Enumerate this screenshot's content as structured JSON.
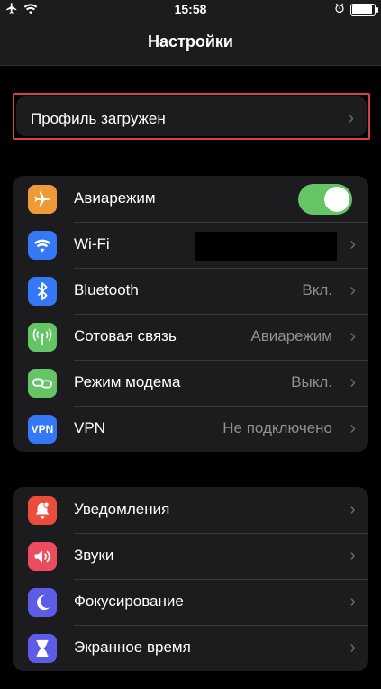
{
  "statusbar": {
    "time": "15:58",
    "battery_level": 0.9
  },
  "navbar": {
    "title": "Настройки"
  },
  "profile": {
    "label": "Профиль загружен"
  },
  "group1": {
    "items": [
      {
        "label": "Авиарежим",
        "icon": "airplane-icon",
        "color": "#f09a37",
        "toggle_on": true
      },
      {
        "label": "Wi-Fi",
        "icon": "wifi-icon",
        "color": "#3478f6",
        "value": ""
      },
      {
        "label": "Bluetooth",
        "icon": "bluetooth-icon",
        "color": "#3478f6",
        "value": "Вкл."
      },
      {
        "label": "Сотовая связь",
        "icon": "antenna-icon",
        "color": "#65c466",
        "value": "Авиарежим"
      },
      {
        "label": "Режим модема",
        "icon": "hotspot-icon",
        "color": "#65c466",
        "value": "Выкл."
      },
      {
        "label": "VPN",
        "icon": "vpn-icon",
        "color": "#3478f6",
        "icon_text": "VPN",
        "value": "Не подключено"
      }
    ]
  },
  "group2": {
    "items": [
      {
        "label": "Уведомления",
        "icon": "bell-icon",
        "color": "#eb4d3d"
      },
      {
        "label": "Звуки",
        "icon": "speaker-icon",
        "color": "#eb4d5f"
      },
      {
        "label": "Фокусирование",
        "icon": "moon-icon",
        "color": "#5e5ce6"
      },
      {
        "label": "Экранное время",
        "icon": "hourglass-icon",
        "color": "#5e5ce6"
      }
    ]
  },
  "colors": {
    "toggle_on": "#65c466",
    "highlight_border": "#d9413f",
    "chevron": "#6b6b70"
  }
}
